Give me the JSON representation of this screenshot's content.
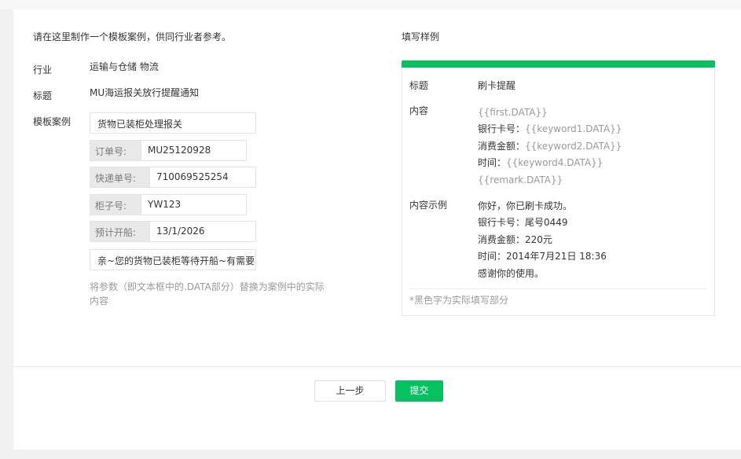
{
  "form": {
    "intro": "请在这里制作一个模板案例，供同行业者参考。",
    "industry_label": "行业",
    "industry_value": "运输与仓储 物流",
    "title_label": "标题",
    "title_value": "MU海运报关放行提醒通知",
    "case_label": "模板案例",
    "first_value": "货物已装柜处理报关",
    "fields": [
      {
        "key": "订单号:",
        "value": "MU25120928"
      },
      {
        "key": "快递单号:",
        "value": "710069525254"
      },
      {
        "key": "柜子号:",
        "value": "YW123"
      },
      {
        "key": "预计开船:",
        "value": "13/1/2026"
      }
    ],
    "remark_value": "亲~您的货物已装柜等待开船~有需要",
    "hint_line1": "将参数（即文本框中的.DATA部分）替换为案例中的实际",
    "hint_line2": "内容"
  },
  "sample": {
    "heading": "填写样例",
    "title_label": "标题",
    "title_value": "刷卡提醒",
    "content_label": "内容",
    "content_lines": [
      {
        "prefix": "",
        "param": "{{first.DATA}}"
      },
      {
        "prefix": "银行卡号：",
        "param": "{{keyword1.DATA}}"
      },
      {
        "prefix": "消费金额：",
        "param": "{{keyword2.DATA}}"
      },
      {
        "prefix": "时间：",
        "param": "{{keyword4.DATA}}"
      },
      {
        "prefix": "",
        "param": "{{remark.DATA}}"
      }
    ],
    "example_label": "内容示例",
    "example_lines": [
      "你好，你已刷卡成功。",
      "银行卡号：尾号0449",
      "消费金额：220元",
      "时间：2014年7月21日 18:36",
      "感谢你的使用。"
    ],
    "footnote": "*黑色字为实际填写部分"
  },
  "actions": {
    "prev_label": "上一步",
    "submit_label": "提交"
  },
  "colors": {
    "accent": "#07c160"
  }
}
